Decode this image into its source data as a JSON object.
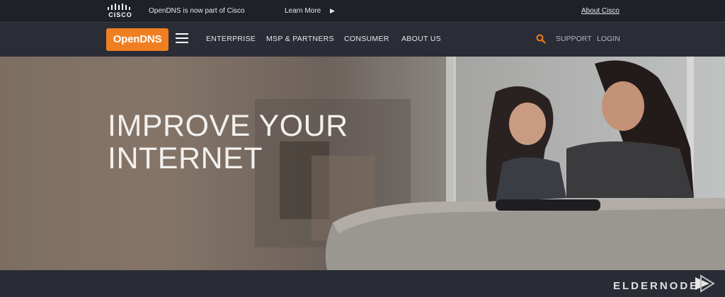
{
  "topbar": {
    "cisco_logo_text": "CISCO",
    "announcement": "OpenDNS is now part of Cisco",
    "learn_more": "Learn More",
    "learn_more_arrow": "▶",
    "about_cisco": "About Cisco"
  },
  "nav": {
    "logo": "OpenDNS",
    "items": [
      "ENTERPRISE",
      "MSP & PARTNERS",
      "CONSUMER",
      "ABOUT US"
    ],
    "support": "SUPPORT",
    "login": "LOGIN",
    "accent_color": "#f07f22"
  },
  "hero": {
    "title_line1": "IMPROVE YOUR",
    "title_line2": "INTERNET"
  },
  "watermark": "ELDERNODE"
}
